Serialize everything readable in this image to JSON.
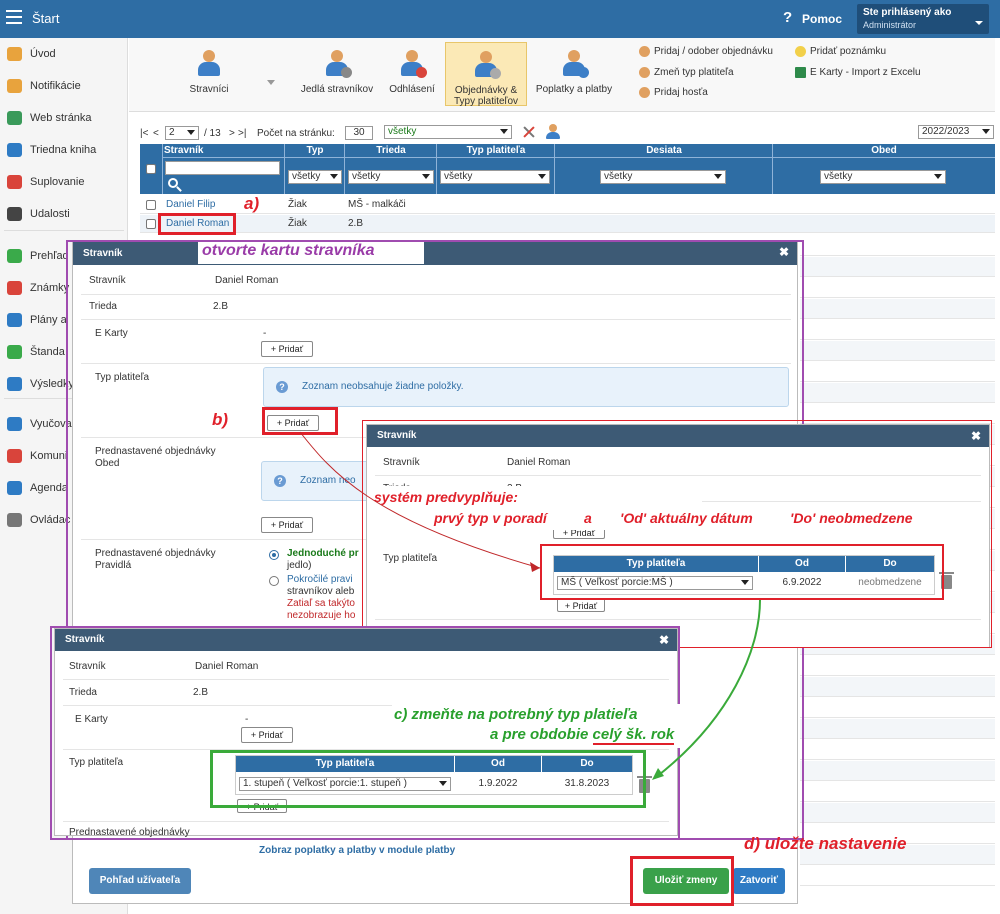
{
  "header": {
    "title": "Štart",
    "help": "Pomoc",
    "user_label": "Ste prihlásený ako",
    "user_role": "Administrátor"
  },
  "sidebar": {
    "items": [
      {
        "label": "Úvod",
        "color": "#e8a33d"
      },
      {
        "label": "Notifikácie",
        "color": "#e8a33d"
      },
      {
        "label": "Web stránka",
        "color": "#3a9a5a"
      },
      {
        "label": "Triedna kniha",
        "color": "#2e7bc4"
      },
      {
        "label": "Suplovanie",
        "color": "#d9443b"
      },
      {
        "label": "Udalosti",
        "color": "#444444"
      },
      {
        "label": "Prehľad",
        "color": "#3aaa4a"
      },
      {
        "label": "Známky",
        "color": "#d9443b"
      },
      {
        "label": "Plány a",
        "color": "#2e7bc4"
      },
      {
        "label": "Štanda",
        "color": "#3aaa4a"
      },
      {
        "label": "Výsledky",
        "color": "#2e7bc4"
      },
      {
        "label": "Vyučova",
        "color": "#2e7bc4"
      },
      {
        "label": "Komuni",
        "color": "#d9443b"
      },
      {
        "label": "Agenda",
        "color": "#2e7bc4"
      },
      {
        "label": "Ovládac",
        "color": "#777777"
      }
    ]
  },
  "toolbar": {
    "buttons": [
      "Stravníci",
      "Jedlá stravníkov",
      "Odhlásení",
      "Objednávky &",
      "Typy platiteľov",
      "Poplatky a platby"
    ],
    "links": [
      "Pridaj / odober objednávku",
      "Zmeň typ platiteľa",
      "Pridaj hosťa",
      "Pridať poznámku",
      "E Karty - Import z Excelu"
    ]
  },
  "pager": {
    "first": "|<",
    "prev": "<",
    "page": "2",
    "of": "/ 13",
    "next": ">",
    "last": ">|",
    "per_page_label": "Počet na stránku:",
    "per_page": "30",
    "filter": "všetky",
    "year": "2022/2023"
  },
  "grid": {
    "columns": [
      "Stravník",
      "Typ",
      "Trieda",
      "Typ platiteľa",
      "Desiata",
      "Obed"
    ],
    "filters": [
      "všetky",
      "všetky",
      "všetky",
      "všetky",
      "všetky"
    ],
    "rows": [
      {
        "name": "Daniel Filip",
        "type": "Žiak",
        "class": "MŠ - malkáči"
      },
      {
        "name": "Daniel Roman",
        "type": "Žiak",
        "class": "2.B"
      }
    ]
  },
  "dialog1": {
    "title": "Stravník",
    "stravnik_label": "Stravník",
    "stravnik": "Daniel Roman",
    "trieda_label": "Trieda",
    "trieda": "2.B",
    "ekarty_label": "E Karty",
    "ekarty": "-",
    "add": "+ Pridať",
    "typ_label": "Typ platiteľa",
    "empty": "Zoznam neobsahuje žiadne položky.",
    "pre_obed_label1": "Prednastavené objednávky",
    "pre_obed_label2": "Obed",
    "empty_short": "Zoznam neo",
    "pre_prav_label1": "Prednastavené objednávky",
    "pre_prav_label2": "Pravidlá",
    "opt1a": "Jednoduché pr",
    "opt1b": "jedlo)",
    "opt2a": "Pokročilé pravi",
    "opt2b": "stravníkov aleb",
    "warn1": "Zatiaľ sa takýto",
    "warn2": "nezobrazuje ho",
    "footer_link": "Zobraz poplatky a platby v module platby",
    "btn_user": "Pohľad užívateľa",
    "btn_save": "Uložiť zmeny",
    "btn_close": "Zatvoriť"
  },
  "dialog2": {
    "title": "Stravník",
    "stravnik_label": "Stravník",
    "stravnik": "Daniel Roman",
    "trieda_label": "Trieda",
    "trieda": "2.B",
    "typ_label": "Typ platiteľa",
    "col_typ": "Typ platiteľa",
    "col_od": "Od",
    "col_do": "Do",
    "row_typ": "MŠ ( Veľkosť porcie:MŠ )",
    "row_od": "6.9.2022",
    "row_do": "neobmedzene",
    "add": "+ Pridať"
  },
  "dialog3": {
    "title": "Stravník",
    "stravnik_label": "Stravník",
    "stravnik": "Daniel Roman",
    "trieda_label": "Trieda",
    "trieda": "2.B",
    "ekarty_label": "E Karty",
    "ekarty": "-",
    "add": "+ Pridať",
    "typ_label": "Typ platiteľa",
    "col_typ": "Typ platiteľa",
    "col_od": "Od",
    "col_do": "Do",
    "row_typ": "1. stupeň ( Veľkosť porcie:1. stupeň )",
    "row_od": "1.9.2022",
    "row_do": "31.8.2023",
    "pre_label": "Prednastavené objednávky"
  },
  "annotations": {
    "a": "a)",
    "a_text": "otvorte kartu stravníka",
    "b": "b)",
    "sys1": "systém predvyplňuje:",
    "sys2a": "prvý typ v poradí",
    "sys2b": "a",
    "sys2c": "'Od' aktuálny dátum",
    "sys2d": "'Do' neobmedzene",
    "c1": "c)   zmeňte na potrebný typ platieľa",
    "c2a": "a  pre obdobie ",
    "c2b": "celý šk. rok",
    "d": "d) uložte nastavenie"
  }
}
